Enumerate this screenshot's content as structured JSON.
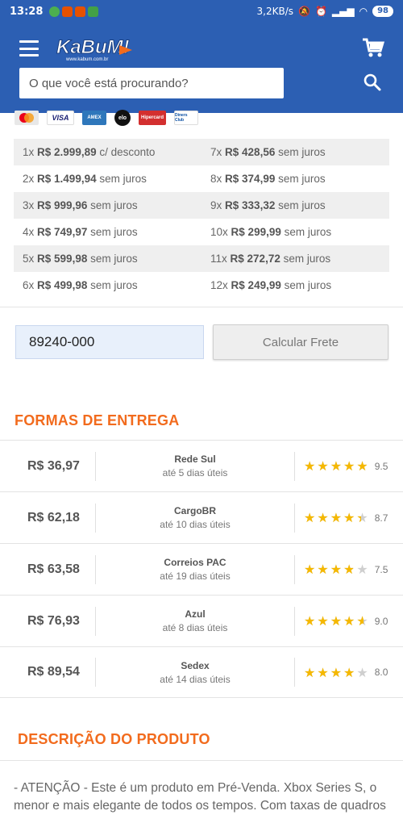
{
  "status_bar": {
    "time": "13:28",
    "speed": "3,2KB/s",
    "battery": "98"
  },
  "header": {
    "logo_text": "KaBuM!",
    "search_placeholder": "O que você está procurando?"
  },
  "payment_cards": [
    "MasterCard",
    "VISA",
    "AMEX",
    "elo",
    "Hipercard",
    "Diners Club"
  ],
  "installments": [
    {
      "left": {
        "n": "1x",
        "value": "R$ 2.999,89",
        "note": "c/ desconto"
      },
      "right": {
        "n": "7x",
        "value": "R$ 428,56",
        "note": "sem juros"
      }
    },
    {
      "left": {
        "n": "2x",
        "value": "R$ 1.499,94",
        "note": "sem juros"
      },
      "right": {
        "n": "8x",
        "value": "R$ 374,99",
        "note": "sem juros"
      }
    },
    {
      "left": {
        "n": "3x",
        "value": "R$ 999,96",
        "note": "sem juros"
      },
      "right": {
        "n": "9x",
        "value": "R$ 333,32",
        "note": "sem juros"
      }
    },
    {
      "left": {
        "n": "4x",
        "value": "R$ 749,97",
        "note": "sem juros"
      },
      "right": {
        "n": "10x",
        "value": "R$ 299,99",
        "note": "sem juros"
      }
    },
    {
      "left": {
        "n": "5x",
        "value": "R$ 599,98",
        "note": "sem juros"
      },
      "right": {
        "n": "11x",
        "value": "R$ 272,72",
        "note": "sem juros"
      }
    },
    {
      "left": {
        "n": "6x",
        "value": "R$ 499,98",
        "note": "sem juros"
      },
      "right": {
        "n": "12x",
        "value": "R$ 249,99",
        "note": "sem juros"
      }
    }
  ],
  "freight": {
    "cep_value": "89240-000",
    "calc_button": "Calcular Frete"
  },
  "delivery_title": "FORMAS DE ENTREGA",
  "delivery_options": [
    {
      "price": "R$ 36,97",
      "name": "Rede Sul",
      "days": "até 5 dias úteis",
      "rating": 9.5,
      "score": "9.5"
    },
    {
      "price": "R$ 62,18",
      "name": "CargoBR",
      "days": "até 10 dias úteis",
      "rating": 8.7,
      "score": "8.7"
    },
    {
      "price": "R$ 63,58",
      "name": "Correios PAC",
      "days": "até 19 dias úteis",
      "rating": 7.5,
      "score": "7.5"
    },
    {
      "price": "R$ 76,93",
      "name": "Azul",
      "days": "até 8 dias úteis",
      "rating": 9.0,
      "score": "9.0"
    },
    {
      "price": "R$ 89,54",
      "name": "Sedex",
      "days": "até 14 dias úteis",
      "rating": 8.0,
      "score": "8.0"
    }
  ],
  "description_title": "DESCRIÇÃO DO PRODUTO",
  "description_text": "- ATENÇÃO - Este é um produto em Pré-Venda. Xbox Series S, o menor e mais elegante de todos os tempos. Com taxas de quadros",
  "colors": {
    "brand_blue": "#2c5fb3",
    "accent_orange": "#f26b1d",
    "star": "#f5b800"
  }
}
